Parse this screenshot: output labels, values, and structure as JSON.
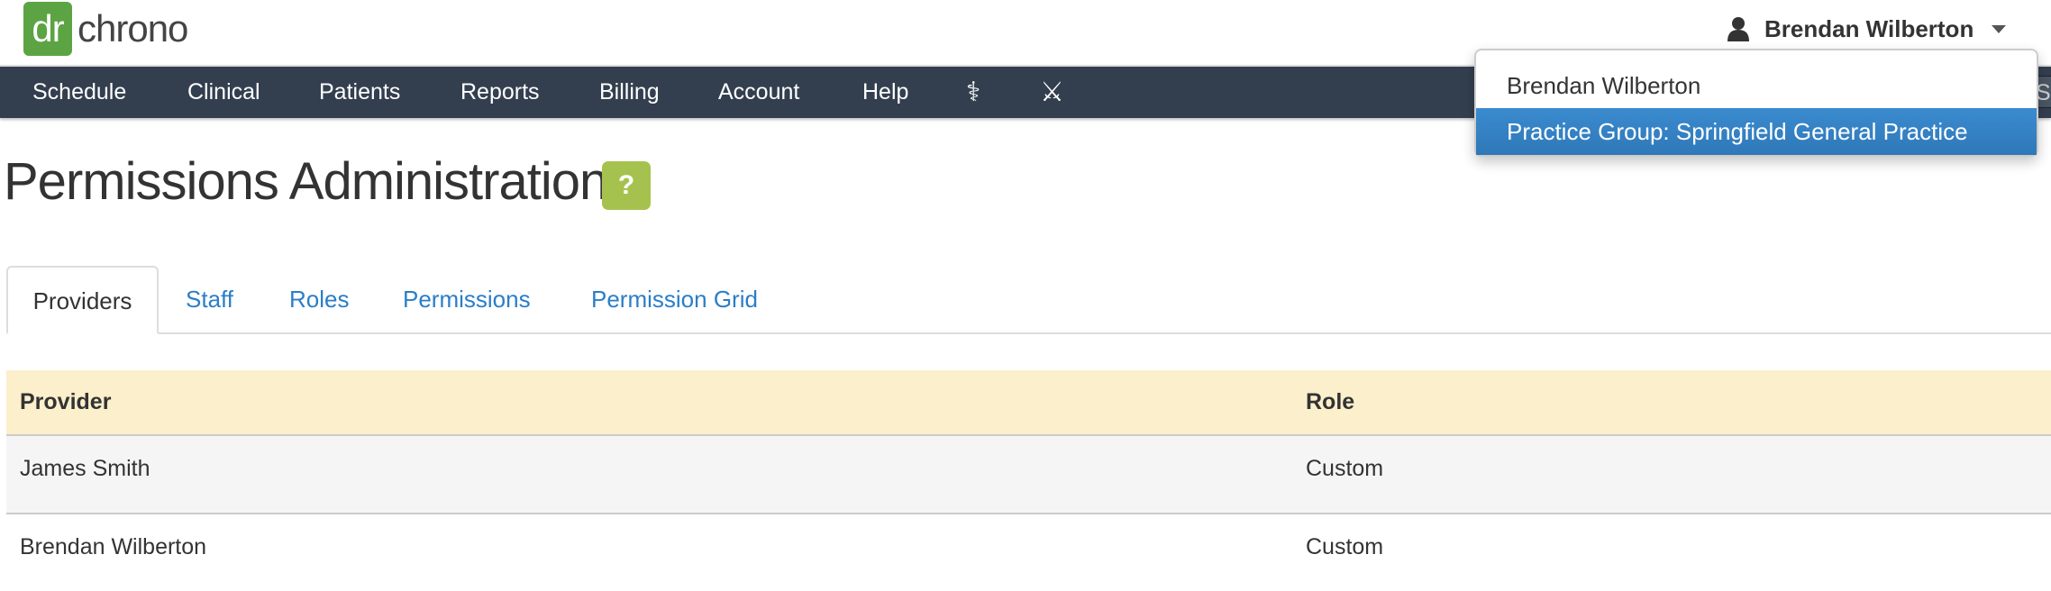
{
  "brand": {
    "logo_mark": "dr",
    "logo_text": "chrono",
    "color": "#5ca443"
  },
  "user_menu": {
    "name": "Brendan Wilberton",
    "icon": "user-icon",
    "items": [
      {
        "label": "Brendan Wilberton",
        "active": false
      },
      {
        "label": "Practice Group: Springfield General Practice",
        "active": true
      }
    ]
  },
  "nav": {
    "items": [
      "Schedule",
      "Clinical",
      "Patients",
      "Reports",
      "Billing",
      "Account",
      "Help"
    ],
    "icons": [
      {
        "name": "staff-of-asclepius-icon",
        "glyph": "⚕"
      },
      {
        "name": "crossed-swords-icon",
        "glyph": "⚔"
      }
    ],
    "search_visible_text": "Se",
    "color": "#333f4f"
  },
  "page": {
    "title": "Permissions Administration",
    "help_label": "?"
  },
  "tabs": [
    {
      "label": "Providers",
      "active": true
    },
    {
      "label": "Staff"
    },
    {
      "label": "Roles"
    },
    {
      "label": "Permissions"
    },
    {
      "label": "Permission Grid"
    }
  ],
  "table": {
    "headers": [
      "Provider",
      "Role"
    ],
    "rows": [
      [
        "James Smith",
        "Custom"
      ],
      [
        "Brendan Wilberton",
        "Custom"
      ]
    ]
  }
}
